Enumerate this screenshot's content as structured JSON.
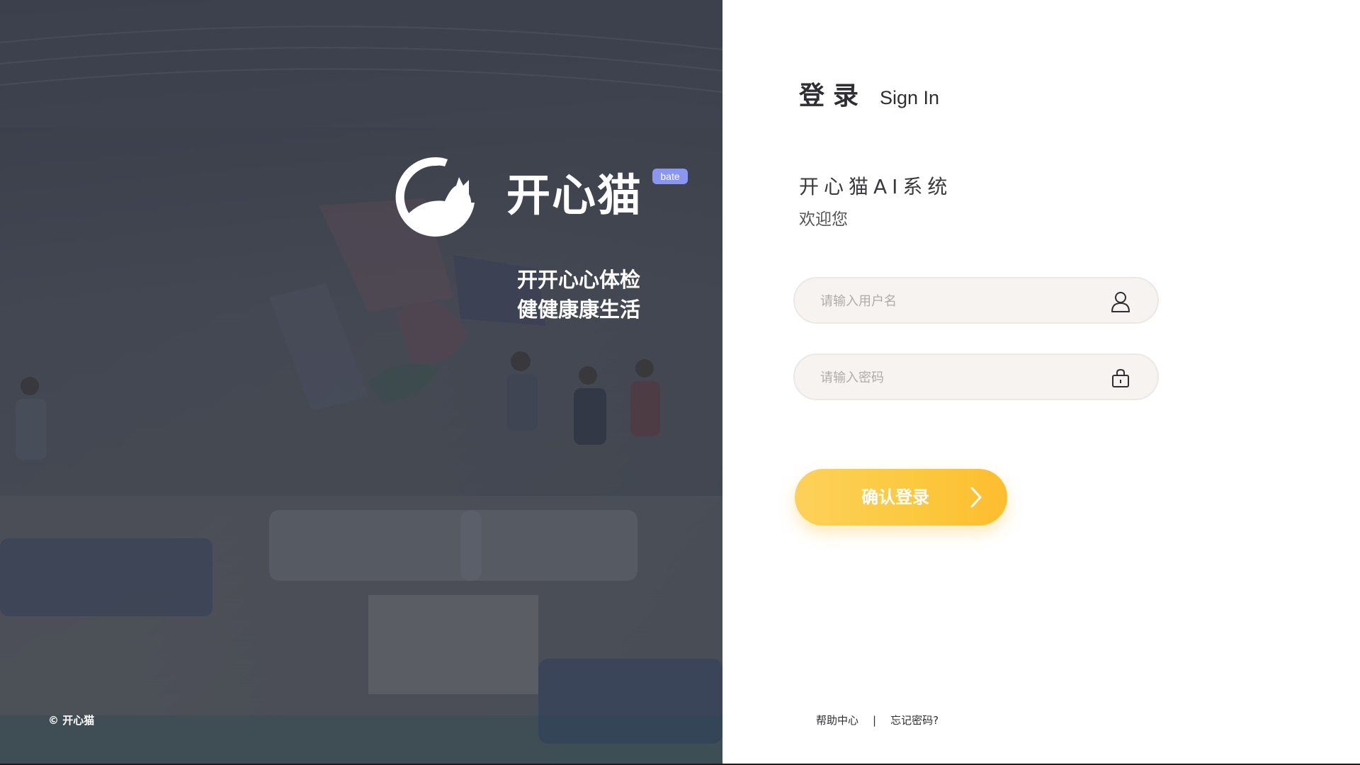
{
  "hero": {
    "brand_name": "开心猫",
    "badge": "bate",
    "slogan_line1": "开开心心体检",
    "slogan_line2": "健健康康生活",
    "copyright": "© 开心猫"
  },
  "login": {
    "title_cn": "登录",
    "title_en": "Sign In",
    "system_name": "开心猫AI系统",
    "welcome": "欢迎您",
    "username_placeholder": "请输入用户名",
    "password_placeholder": "请输入密码",
    "submit_label": "确认登录",
    "footer": {
      "help_center": "帮助中心",
      "separator": "|",
      "forgot_password": "忘记密码?"
    }
  },
  "colors": {
    "accent_yellow": "#fcc93f",
    "badge_purple": "#8b96f0",
    "input_bg": "#f6f3f1",
    "text_dark": "#2f2f33"
  },
  "icons": {
    "logo": "cat-logo-icon",
    "username_field": "user-icon",
    "password_field": "lock-icon",
    "submit": "chevron-right-icon"
  }
}
